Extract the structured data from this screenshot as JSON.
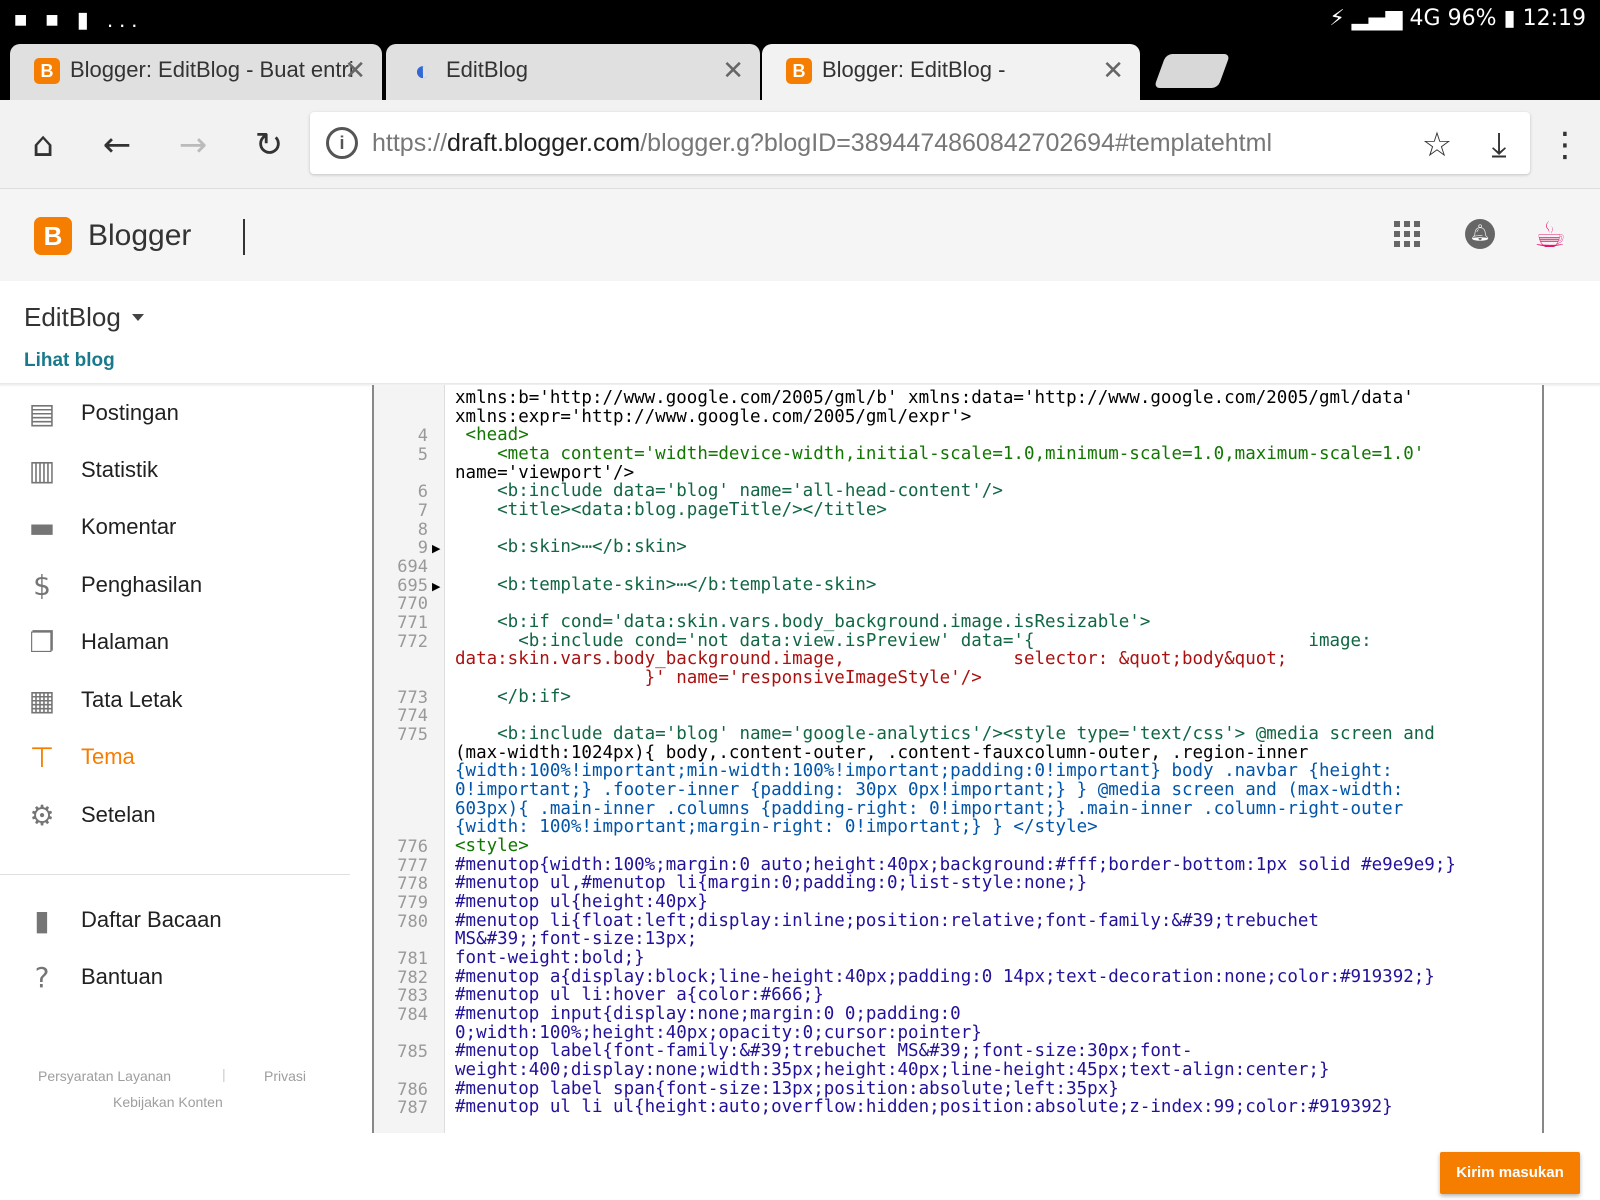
{
  "status_bar": {
    "left_icons": "■ ■ ▮ ...",
    "battery": "96%",
    "time": "12:19",
    "network": "4G"
  },
  "tabs": [
    {
      "label": "Blogger: EditBlog - Buat entri",
      "icon": "blogger-icon"
    },
    {
      "label": "EditBlog",
      "icon": "loading-icon"
    },
    {
      "label": "Blogger: EditBlog -",
      "icon": "blogger-icon"
    }
  ],
  "toolbar": {
    "url_scheme": "https://",
    "url_host": "draft.blogger.com",
    "url_path": "/blogger.g?blogID=3894474860842702694#templatehtml"
  },
  "app": {
    "name": "Blogger",
    "logo_letter": "B"
  },
  "blog": {
    "title": "EditBlog",
    "view_link": "Lihat blog"
  },
  "sidebar": {
    "items": [
      {
        "label": "Postingan",
        "icon": "posts-icon",
        "glyph": "▤"
      },
      {
        "label": "Statistik",
        "icon": "stats-icon",
        "glyph": "▥"
      },
      {
        "label": "Komentar",
        "icon": "comment-icon",
        "glyph": "▬"
      },
      {
        "label": "Penghasilan",
        "icon": "dollar-icon",
        "glyph": "$"
      },
      {
        "label": "Halaman",
        "icon": "pages-icon",
        "glyph": "❐"
      },
      {
        "label": "Tata Letak",
        "icon": "layout-icon",
        "glyph": "▦"
      },
      {
        "label": "Tema",
        "icon": "theme-icon",
        "glyph": "⊤"
      },
      {
        "label": "Setelan",
        "icon": "settings-icon",
        "glyph": "⚙"
      }
    ],
    "secondary": [
      {
        "label": "Daftar Bacaan",
        "icon": "bookmark-icon",
        "glyph": "▮"
      },
      {
        "label": "Bantuan",
        "icon": "help-icon",
        "glyph": "?"
      }
    ],
    "footer": {
      "terms": "Persyaratan Layanan",
      "privacy": "Privasi",
      "content_policy": "Kebijakan Konten"
    }
  },
  "editor": {
    "line_numbers": [
      "4",
      "5",
      "6",
      "7",
      "8",
      "9",
      "694",
      "695",
      "770",
      "771",
      "772",
      "773",
      "774",
      "775",
      "776",
      "777",
      "778",
      "779",
      "780",
      "781",
      "782",
      "783",
      "784",
      "785",
      "786",
      "787"
    ],
    "lines": [
      "xmlns:b='http://www.google.com/2005/gml/b' xmlns:data='http://www.google.com/2005/gml/data'",
      "xmlns:expr='http://www.google.com/2005/gml/expr'>",
      " <head>",
      "    <meta content='width=device-width,initial-scale=1.0,minimum-scale=1.0,maximum-scale=1.0'",
      "name='viewport'/>",
      "    <b:include data='blog' name='all-head-content'/>",
      "    <title><data:blog.pageTitle/></title>",
      "",
      "    <b:skin>⋯</b:skin>",
      "",
      "    <b:template-skin>⋯</b:template-skin>",
      "",
      "    <b:if cond='data:skin.vars.body_background.image.isResizable'>",
      "      <b:include cond='not data:view.isPreview' data='{                          image:",
      "data:skin.vars.body_background.image,                selector: &quot;body&quot;",
      "                  }' name='responsiveImageStyle'/>",
      "    </b:if>",
      "",
      "    <b:include data='blog' name='google-analytics'/><style type='text/css'> @media screen and",
      "(max-width:1024px){ body,.content-outer, .content-fauxcolumn-outer, .region-inner",
      "{width:100%!important;min-width:100%!important;padding:0!important} body .navbar {height:",
      "0!important;} .footer-inner {padding: 30px 0px!important;} } @media screen and (max-width:",
      "603px){ .main-inner .columns {padding-right: 0!important;} .main-inner .column-right-outer",
      "{width: 100%!important;margin-right: 0!important;} } </style>",
      "<style>",
      "#menutop{width:100%;margin:0 auto;height:40px;background:#fff;border-bottom:1px solid #e9e9e9;}",
      "#menutop ul,#menutop li{margin:0;padding:0;list-style:none;}",
      "#menutop ul{height:40px}",
      "#menutop li{float:left;display:inline;position:relative;font-family:&#39;trebuchet",
      "MS&#39;;font-size:13px;",
      "font-weight:bold;}",
      "#menutop a{display:block;line-height:40px;padding:0 14px;text-decoration:none;color:#919392;}",
      "#menutop ul li:hover a{color:#666;}",
      "#menutop input{display:none;margin:0 0;padding:0",
      "0;width:100%;height:40px;opacity:0;cursor:pointer}",
      "#menutop label{font-family:&#39;trebuchet MS&#39;;font-size:30px;font-",
      "weight:400;display:none;width:35px;height:40px;line-height:45px;text-align:center;}",
      "#menutop label span{font-size:13px;position:absolute;left:35px}",
      "#menutop ul li ul{height:auto;overflow:hidden;position:absolute;z-index:99;color:#919392}"
    ]
  },
  "submit_feedback": "Kirim masukan",
  "colors": {
    "accent": "#f57d00",
    "link": "#1a7a8c",
    "avatar": "#e5156e"
  }
}
